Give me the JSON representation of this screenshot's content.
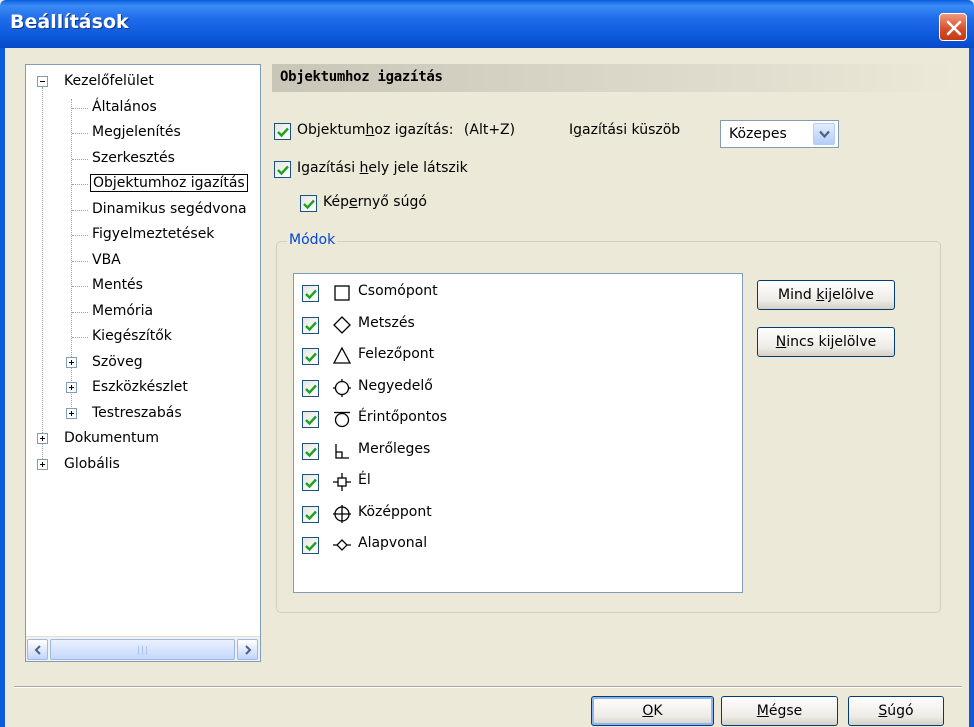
{
  "window": {
    "title": "Beállítások"
  },
  "tree": {
    "items": [
      {
        "label": "Kezelőfelület",
        "level": 0,
        "expander": "minus"
      },
      {
        "label": "Általános",
        "level": 1
      },
      {
        "label": "Megjelenítés",
        "level": 1
      },
      {
        "label": "Szerkesztés",
        "level": 1
      },
      {
        "label": "Objektumhoz igazítás",
        "level": 1,
        "selected": true
      },
      {
        "label": "Dinamikus segédvona",
        "level": 1
      },
      {
        "label": "Figyelmeztetések",
        "level": 1
      },
      {
        "label": "VBA",
        "level": 1
      },
      {
        "label": "Mentés",
        "level": 1
      },
      {
        "label": "Memória",
        "level": 1
      },
      {
        "label": "Kiegészítők",
        "level": 1
      },
      {
        "label": "Szöveg",
        "level": 1,
        "expander": "plus"
      },
      {
        "label": "Eszközkészlet",
        "level": 1,
        "expander": "plus"
      },
      {
        "label": "Testreszabás",
        "level": 1,
        "expander": "plus"
      },
      {
        "label": "Dokumentum",
        "level": 0,
        "expander": "plus"
      },
      {
        "label": "Globális",
        "level": 0,
        "expander": "plus"
      }
    ],
    "scroll_grip": "|||"
  },
  "panel": {
    "title": "Objektumhoz igazítás",
    "snap_checkbox": {
      "pre": "Objektum",
      "mn": "h",
      "post": "oz igazítás:",
      "shortcut": "(Alt+Z)",
      "checked": true
    },
    "threshold_label": {
      "pre": "I",
      "mn": "g",
      "post": "azítási küszöb"
    },
    "threshold_value": "Közepes",
    "marker_checkbox": {
      "pre": "Igazítási ",
      "mn": "h",
      "post": "ely jele látszik",
      "checked": true
    },
    "tooltip_checkbox": {
      "pre": "Kép",
      "mn": "e",
      "post": "rnyő súgó",
      "checked": true
    },
    "modes_group_title": "Módok",
    "modes": [
      {
        "label": "Csomópont",
        "symbol": "square-icon",
        "checked": true
      },
      {
        "label": "Metszés",
        "symbol": "diamond-icon",
        "checked": true
      },
      {
        "label": "Felezőpont",
        "symbol": "triangle-icon",
        "checked": true
      },
      {
        "label": "Negyedelő",
        "symbol": "quadrant-icon",
        "checked": true
      },
      {
        "label": "Érintőpontos",
        "symbol": "tangent-icon",
        "checked": true
      },
      {
        "label": "Merőleges",
        "symbol": "perpendicular-icon",
        "checked": true
      },
      {
        "label": "Él",
        "symbol": "edge-icon",
        "checked": true
      },
      {
        "label": "Középpont",
        "symbol": "center-icon",
        "checked": true
      },
      {
        "label": "Alapvonal",
        "symbol": "baseline-icon",
        "checked": true
      }
    ],
    "select_all_button": {
      "pre": "Mind ",
      "mn": "k",
      "post": "ijelölve"
    },
    "select_none_button": {
      "pre": "",
      "mn": "N",
      "post": "incs kijelölve"
    }
  },
  "footer": {
    "ok_button": {
      "pre": "",
      "mn": "O",
      "post": "K"
    },
    "cancel_button": {
      "pre": "",
      "mn": "M",
      "post": "égse"
    },
    "help_button": {
      "pre": "",
      "mn": "S",
      "post": "úgó"
    }
  }
}
